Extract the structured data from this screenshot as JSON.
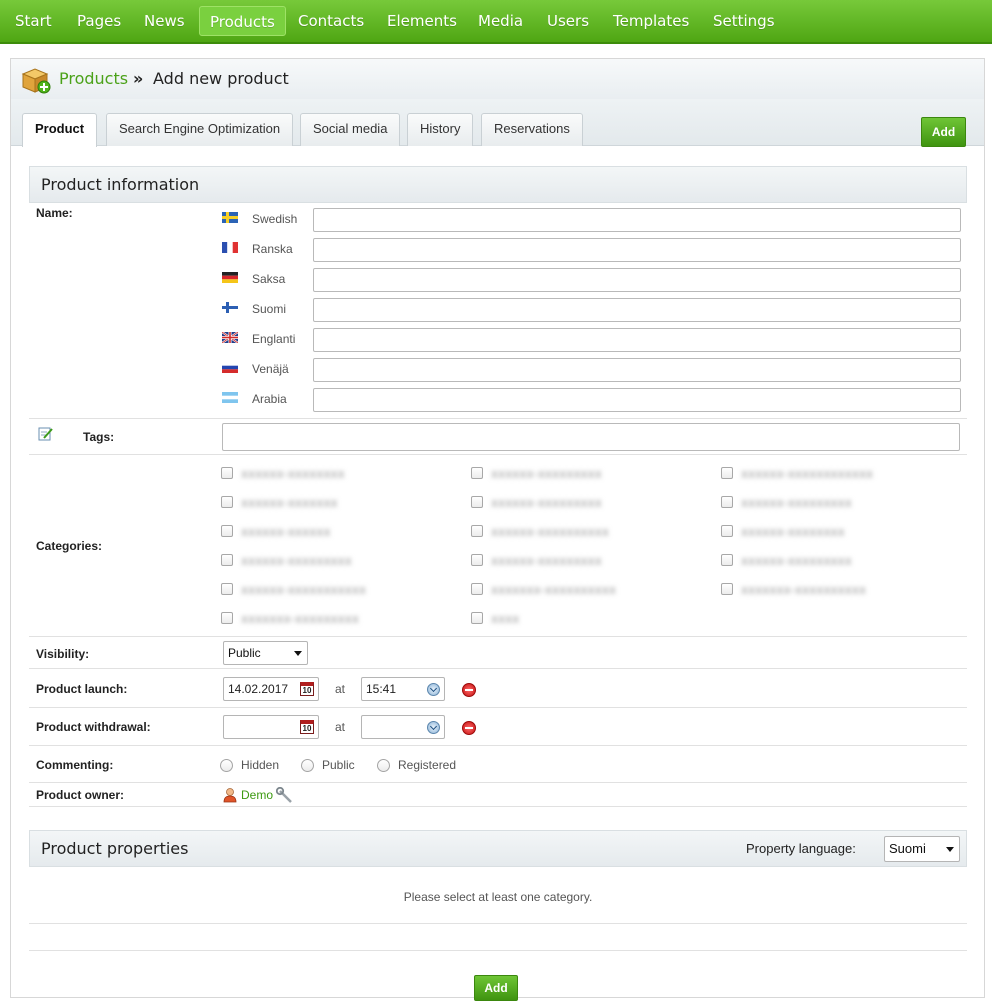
{
  "nav": {
    "items": [
      "Start",
      "Pages",
      "News",
      "Products",
      "Contacts",
      "Elements",
      "Media",
      "Users",
      "Templates",
      "Settings"
    ],
    "active": "Products"
  },
  "breadcrumb": {
    "parent": "Products",
    "separator": "»",
    "current": "Add new product"
  },
  "tabs": [
    "Product",
    "Search Engine Optimization",
    "Social media",
    "History",
    "Reservations"
  ],
  "add_button": "Add",
  "product_info": {
    "title": "Product information",
    "name_label": "Name:",
    "languages": [
      "Swedish",
      "Ranska",
      "Saksa",
      "Suomi",
      "Englanti",
      "Venäjä",
      "Arabia"
    ],
    "tags_label": "Tags:",
    "categories_label": "Categories:",
    "categories": [
      "xxxxxx-xxxxxxxx",
      "xxxxxx-xxxxxxxxx",
      "xxxxxx-xxxxxxxxxxxx",
      "xxxxxx-xxxxxxx",
      "xxxxxx-xxxxxxxxx",
      "xxxxxx-xxxxxxxxx",
      "xxxxxx-xxxxxx",
      "xxxxxx-xxxxxxxxxx",
      "xxxxxx-xxxxxxxx",
      "xxxxxx-xxxxxxxxx",
      "xxxxxx-xxxxxxxxx",
      "xxxxxx-xxxxxxxxx",
      "xxxxxx-xxxxxxxxxxx",
      "xxxxxxx-xxxxxxxxxx",
      "xxxxxxx-xxxxxxxxxx",
      "xxxxxxx-xxxxxxxxx",
      "xxxx"
    ],
    "visibility_label": "Visibility:",
    "visibility_value": "Public",
    "launch_label": "Product launch:",
    "launch_date": "14.02.2017",
    "launch_time": "15:41",
    "withdrawal_label": "Product withdrawal:",
    "withdrawal_date": "",
    "withdrawal_time": "",
    "at": "at",
    "calendar_day": "10",
    "commenting_label": "Commenting:",
    "commenting_options": [
      "Hidden",
      "Public",
      "Registered"
    ],
    "owner_label": "Product owner:",
    "owner_name": "Demo"
  },
  "product_properties": {
    "title": "Product properties",
    "language_label": "Property language:",
    "language_value": "Suomi",
    "message": "Please select at least one category."
  },
  "colors": {
    "brand_green": "#4fa613",
    "link_green": "#3d9a12"
  }
}
